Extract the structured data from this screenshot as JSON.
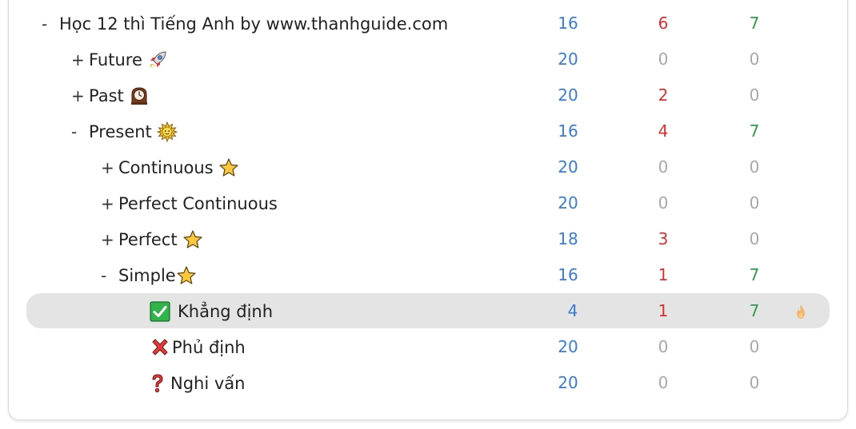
{
  "colors": {
    "new": "#3a7bd5",
    "learn": "#d92f2f",
    "due": "#2e9e48",
    "zero": "#a8a8a8",
    "selected_bg": "#e4e4e4"
  },
  "decks": [
    {
      "toggle": "-",
      "name": "Học 12 thì Tiếng Anh by www.thanhguide.com",
      "icon": "",
      "level": 0,
      "new": "16",
      "learn": "6",
      "due": "7"
    },
    {
      "toggle": "+",
      "name": "Future",
      "icon": "rocket-icon",
      "level": 1,
      "new": "20",
      "learn": "0",
      "due": "0"
    },
    {
      "toggle": "+",
      "name": "Past",
      "icon": "clock-icon",
      "level": 1,
      "new": "20",
      "learn": "2",
      "due": "0"
    },
    {
      "toggle": "-",
      "name": "Present",
      "icon": "sun-icon",
      "level": 1,
      "new": "16",
      "learn": "4",
      "due": "7"
    },
    {
      "toggle": "+",
      "name": "Continuous",
      "icon": "star-icon",
      "level": 2,
      "new": "20",
      "learn": "0",
      "due": "0"
    },
    {
      "toggle": "+",
      "name": "Perfect Continuous",
      "icon": "",
      "level": 2,
      "new": "20",
      "learn": "0",
      "due": "0"
    },
    {
      "toggle": "+",
      "name": "Perfect",
      "icon": "star-icon",
      "level": 2,
      "new": "18",
      "learn": "3",
      "due": "0"
    },
    {
      "toggle": "-",
      "name": "Simple",
      "icon": "star-icon",
      "level": 2,
      "new": "16",
      "learn": "1",
      "due": "7"
    },
    {
      "toggle": "",
      "name": "Khẳng định",
      "icon": "check-box-icon",
      "level": 3,
      "new": "4",
      "learn": "1",
      "due": "7",
      "selected": true
    },
    {
      "toggle": "",
      "name": "Phủ định",
      "icon": "cross-icon",
      "level": 3,
      "new": "20",
      "learn": "0",
      "due": "0"
    },
    {
      "toggle": "",
      "name": "Nghi vấn",
      "icon": "question-icon",
      "level": 3,
      "new": "20",
      "learn": "0",
      "due": "0"
    }
  ]
}
